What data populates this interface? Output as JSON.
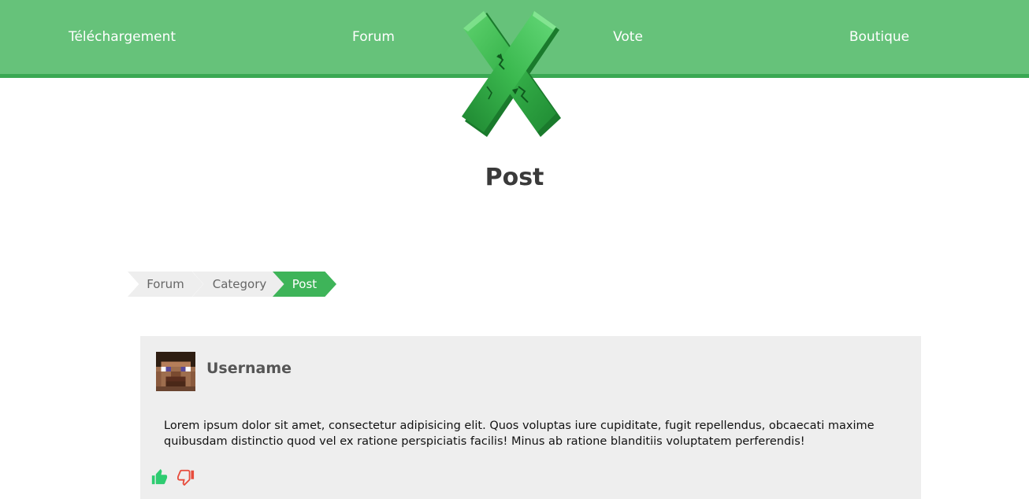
{
  "nav": {
    "items": [
      {
        "label": "Téléchargement"
      },
      {
        "label": "Forum"
      },
      {
        "label": "Vote"
      },
      {
        "label": "Boutique"
      }
    ],
    "colors": {
      "background": "#66c27a",
      "border": "#3aa853"
    }
  },
  "logo": {
    "icon": "green-x-logo-icon"
  },
  "page": {
    "title": "Post"
  },
  "breadcrumb": {
    "items": [
      {
        "label": "Forum"
      },
      {
        "label": "Category"
      },
      {
        "label": "Post"
      }
    ],
    "active_color": "#3eb459"
  },
  "post": {
    "username": "Username",
    "avatar_icon": "player-head-avatar-icon",
    "body": "Lorem ipsum dolor sit amet, consectetur adipisicing elit. Quos voluptas iure cupiditate, fugit repellendus, obcaecati maxime quibusdam distinctio quod vel ex ratione perspiciatis facilis! Minus ab ratione blanditiis voluptatem perferendis!",
    "like_icon": "thumbs-up-icon",
    "dislike_icon": "thumbs-down-icon",
    "like_color": "#2ecc71",
    "dislike_color": "#e74c3c"
  }
}
